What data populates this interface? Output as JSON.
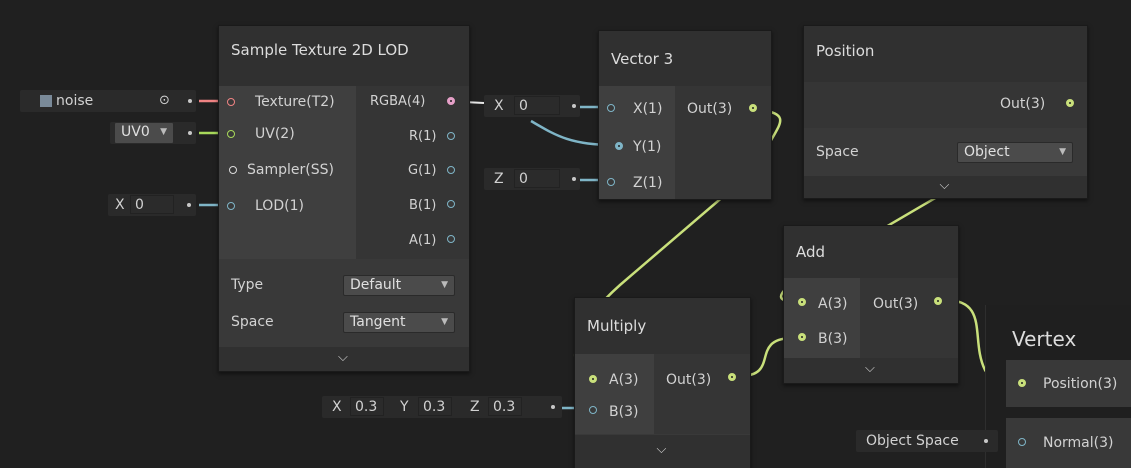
{
  "nodes": {
    "sample_texture": {
      "title": "Sample Texture 2D LOD",
      "inputs": [
        "Texture(T2)",
        "UV(2)",
        "Sampler(SS)",
        "LOD(1)"
      ],
      "outputs": [
        "RGBA(4)",
        "R(1)",
        "G(1)",
        "B(1)",
        "A(1)"
      ],
      "settings": [
        {
          "label": "Type",
          "value": "Default"
        },
        {
          "label": "Space",
          "value": "Tangent"
        }
      ]
    },
    "vector3": {
      "title": "Vector 3",
      "inputs": [
        "X(1)",
        "Y(1)",
        "Z(1)"
      ],
      "output": "Out(3)"
    },
    "position": {
      "title": "Position",
      "output": "Out(3)",
      "setting": {
        "label": "Space",
        "value": "Object"
      }
    },
    "add": {
      "title": "Add",
      "inputs": [
        "A(3)",
        "B(3)"
      ],
      "output": "Out(3)"
    },
    "multiply": {
      "title": "Multiply",
      "inputs": [
        "A(3)",
        "B(3)"
      ],
      "output": "Out(3)"
    },
    "vertex": {
      "title": "Vertex",
      "inputs": [
        "Position(3)",
        "Normal(3)"
      ]
    }
  },
  "fields": {
    "texture": {
      "value": "noise"
    },
    "uv": {
      "value": "UV0"
    },
    "lod": {
      "axis": "X",
      "value": "0"
    },
    "vec_x": {
      "axis": "X",
      "value": "0"
    },
    "vec_z": {
      "axis": "Z",
      "value": "0"
    },
    "mul_b": {
      "x_label": "X",
      "x": "0.3",
      "y_label": "Y",
      "y": "0.3",
      "z_label": "Z",
      "z": "0.3"
    },
    "normal_space": {
      "value": "Object Space"
    }
  },
  "colors": {
    "background": "#202020",
    "node": "#393939",
    "vector3_wire": "#c9e07b",
    "float_wire": "#7fb5c7",
    "texture_wire": "#f08484",
    "uv_wire": "#a8d95b",
    "rgba_port": "#e6a0c8"
  },
  "icons": [
    "texture-thumbnail-icon",
    "object-picker-icon",
    "dropdown-arrow-icon",
    "chevron-down-icon"
  ]
}
